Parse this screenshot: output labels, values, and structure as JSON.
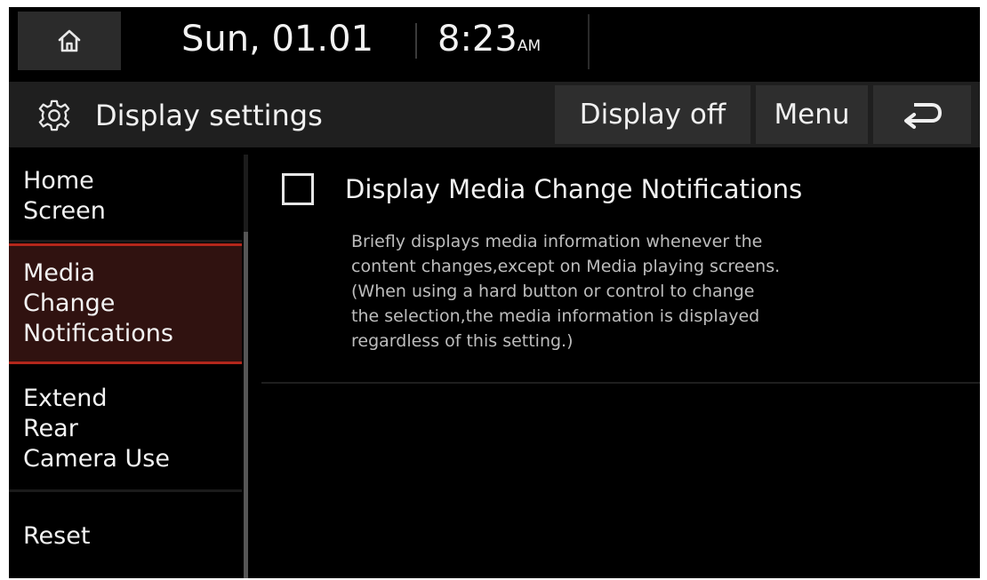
{
  "status_bar": {
    "home_icon": "home-icon",
    "date": "Sun, 01.01",
    "time": "8:23",
    "ampm": "AM"
  },
  "title_bar": {
    "settings_icon": "gear-icon",
    "title": "Display settings",
    "display_off_label": "Display off",
    "menu_label": "Menu",
    "back_icon": "back-arrow-icon"
  },
  "sidebar": {
    "items": [
      {
        "label": "Home\nScreen",
        "selected": false
      },
      {
        "label": "Media\nChange\nNotifications",
        "selected": true
      },
      {
        "label": "Extend\nRear\nCamera Use",
        "selected": false
      },
      {
        "label": "Reset",
        "selected": false
      }
    ]
  },
  "content": {
    "option": {
      "checked": false,
      "title": "Display Media Change Notifications",
      "description": "Briefly displays media information whenever the\ncontent changes,except on Media playing screens.\n(When using a hard button or control to change\nthe selection,the media information is displayed\nregardless of this setting.)"
    }
  },
  "colors": {
    "selected_accent": "#b3271b",
    "selected_background": "#301210",
    "bar_background": "#1f1f1f",
    "button_background": "#2e2e2e"
  }
}
